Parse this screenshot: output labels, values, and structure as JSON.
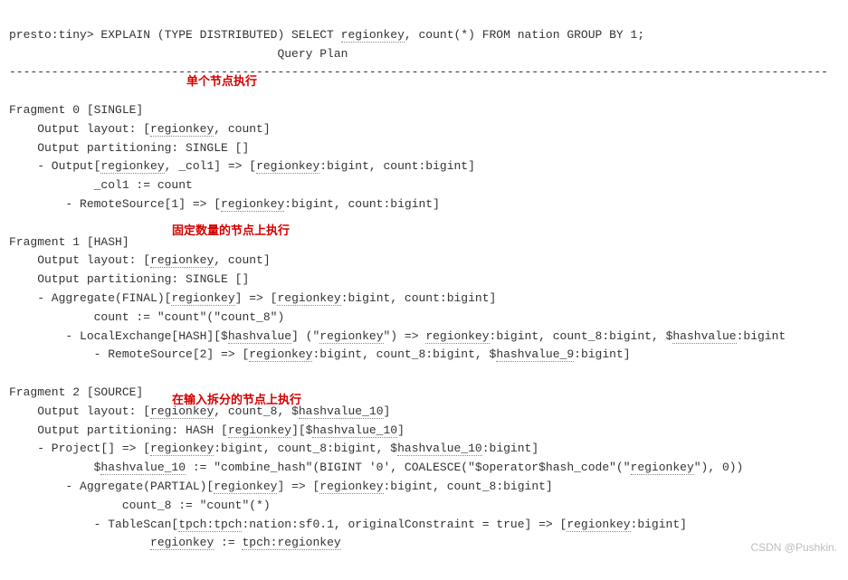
{
  "prompt": {
    "prefix": "presto:tiny> EXPLAIN (TYPE DISTRIBUTED) SELECT ",
    "col": "regionkey",
    "suffix": ", count(*) FROM nation GROUP BY 1;"
  },
  "planTitleIndent": "                                      ",
  "planTitle": "Query Plan",
  "divider": "--------------------------------------------------------------------------------------------------------------------",
  "annotations": {
    "frag0": "单个节点执行",
    "frag1": "固定数量的节点上执行",
    "frag2": "在输入拆分的节点上执行"
  },
  "frag0": {
    "header": "Fragment 0 [SINGLE]",
    "outLayout_pre": "    Output layout: [",
    "outLayout_col": "regionkey",
    "outLayout_post": ", count]",
    "outPart": "    Output partitioning: SINGLE []",
    "output_pre": "    - Output[",
    "output_col": "regionkey",
    "output_mid": ", _col1] => [",
    "output_col2": "regionkey",
    "output_post": ":bigint, count:bigint]",
    "col1": "            _col1 := count",
    "remote_pre": "        - RemoteSource[1] => [",
    "remote_col": "regionkey",
    "remote_post": ":bigint, count:bigint]"
  },
  "frag1": {
    "header": "Fragment 1 [HASH]",
    "outLayout_pre": "    Output layout: [",
    "outLayout_col": "regionkey",
    "outLayout_post": ", count]",
    "outPart": "    Output partitioning: SINGLE []",
    "agg_pre": "    - Aggregate(FINAL)[",
    "agg_c1": "regionkey",
    "agg_mid1": "] => [",
    "agg_c2": "regionkey",
    "agg_post": ":bigint, count:bigint]",
    "countLine": "            count := \"count\"(\"count_8\")",
    "lex_pre": "        - LocalExchange[HASH][$",
    "lex_hv": "hashvalue",
    "lex_mid1": "] (\"",
    "lex_rk": "regionkey",
    "lex_mid2": "\") => ",
    "lex_rk2": "regionkey",
    "lex_mid3": ":bigint, count_8:bigint, $",
    "lex_hv2": "hashvalue",
    "lex_post": ":bigint",
    "rs_pre": "            - RemoteSource[2] => [",
    "rs_rk": "regionkey",
    "rs_mid": ":bigint, count_8:bigint, $",
    "rs_hv": "hashvalue_9",
    "rs_post": ":bigint]"
  },
  "frag2": {
    "header": "Fragment 2 [SOURCE]",
    "ol_pre": "    Output layout: [",
    "ol_rk": "regionkey",
    "ol_mid": ", count_8, $",
    "ol_hv": "hashvalue_10",
    "ol_post": "]",
    "op_pre": "    Output partitioning: HASH [",
    "op_rk": "regionkey",
    "op_mid": "][$",
    "op_hv": "hashvalue_10",
    "op_post": "]",
    "prj_pre": "    - Project[] => [",
    "prj_rk": "regionkey",
    "prj_mid1": ":bigint, count_8:bigint, $",
    "prj_hv": "hashvalue_10",
    "prj_post": ":bigint]",
    "hash_pre": "            $",
    "hash_hv": "hashvalue_10",
    "hash_mid1": " := \"combine_hash\"(BIGINT '0', COALESCE(\"$operator$hash_code\"(\"",
    "hash_rk": "regionkey",
    "hash_post": "\"), 0))",
    "agg_pre": "        - Aggregate(PARTIAL)[",
    "agg_rk": "regionkey",
    "agg_mid": "] => [",
    "agg_rk2": "regionkey",
    "agg_post": ":bigint, count_8:bigint]",
    "countLine": "                count_8 := \"count\"(*)",
    "ts_pre": "            - TableScan[",
    "ts_tab": "tpch:tpch",
    "ts_mid1": ":nation:sf0.1, originalConstraint = true] => [",
    "ts_rk": "regionkey",
    "ts_post": ":bigint]",
    "last_pre": "                    ",
    "last_rk": "regionkey",
    "last_mid": " := ",
    "last_src": "tpch:regionkey"
  },
  "watermark": "CSDN @Pushkin."
}
